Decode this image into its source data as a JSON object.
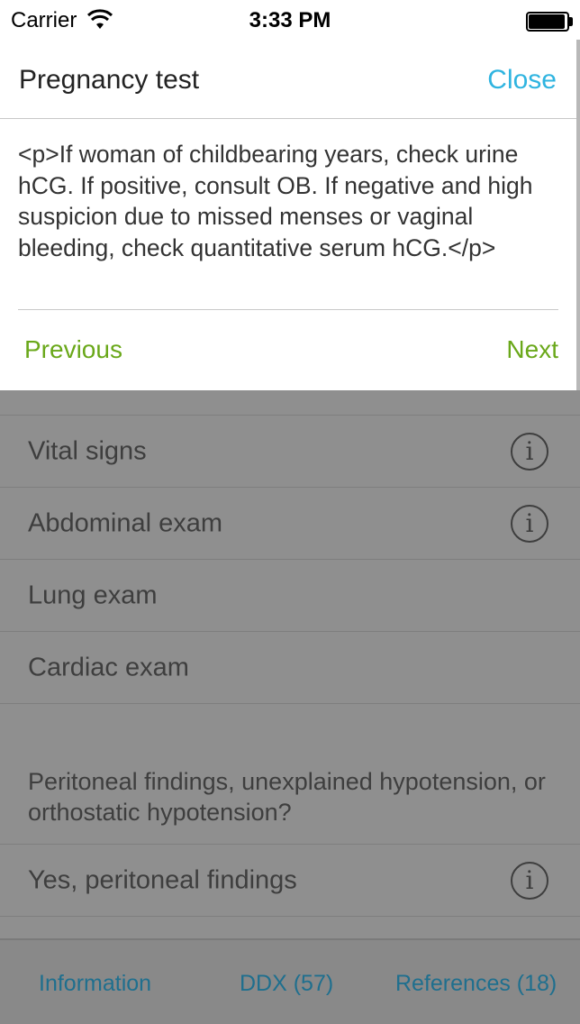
{
  "status_bar": {
    "carrier": "Carrier",
    "time": "3:33 PM"
  },
  "list": {
    "partial_row_icon": "info-icon",
    "rows": [
      {
        "label": "Vital signs",
        "has_info": true
      },
      {
        "label": "Abdominal exam",
        "has_info": true
      },
      {
        "label": "Lung exam",
        "has_info": false
      },
      {
        "label": "Cardiac exam",
        "has_info": false
      }
    ],
    "section_question": "Peritoneal findings, unexplained hypotension, or orthostatic hypotension?",
    "answer_row": {
      "label": "Yes, peritoneal findings",
      "has_info": true
    }
  },
  "info_glyph": "i",
  "tab_bar": {
    "tabs": [
      {
        "label": "Information"
      },
      {
        "label": "DDX (57)"
      },
      {
        "label": "References (18)"
      }
    ]
  },
  "popover": {
    "title": "Pregnancy test",
    "close_label": "Close",
    "body": "<p>If woman of childbearing years, check urine hCG. If positive, consult OB. If negative and high suspicion due to missed menses or vaginal bleeding, check quantitative serum hCG.</p>",
    "previous_label": "Previous",
    "next_label": "Next"
  },
  "colors": {
    "accent_blue": "#2fb4e0",
    "nav_green": "#6aa81a",
    "tab_text": "#1f6f8e"
  }
}
